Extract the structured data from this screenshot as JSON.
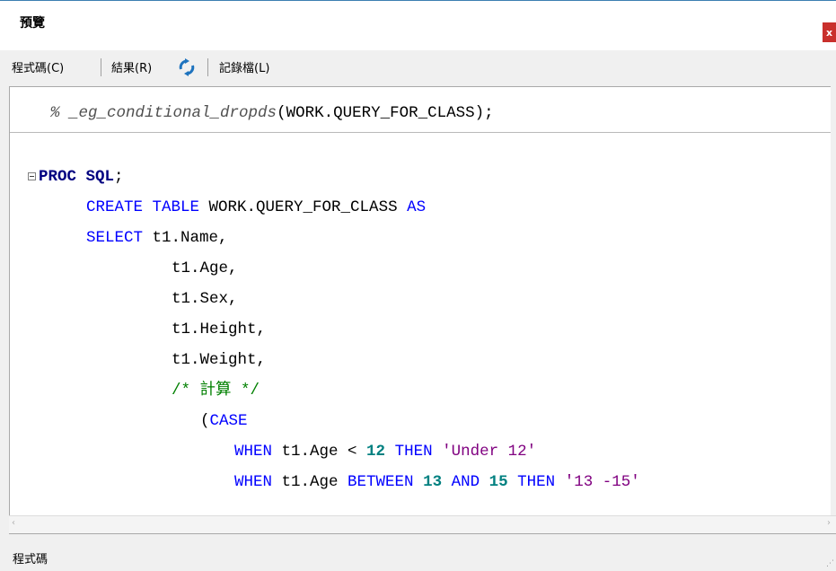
{
  "window": {
    "title": "預覽",
    "close_label": "x"
  },
  "toolbar": {
    "code_label": "程式碼(C)",
    "results_label": "結果(R)",
    "log_label": "記錄檔(L)"
  },
  "editor": {
    "lines": [
      {
        "parts": [
          [
            "macro",
            "% "
          ],
          [
            "macro",
            "_eg_conditional_dropds"
          ],
          [
            "plain",
            "(WORK.QUERY_FOR_CLASS);"
          ]
        ]
      },
      {
        "parts": [
          [
            "kwb",
            "PROC SQL"
          ],
          [
            "plain",
            ";"
          ]
        ]
      },
      {
        "parts": [
          [
            "kw",
            "CREATE TABLE"
          ],
          [
            "plain",
            " WORK.QUERY_FOR_CLASS "
          ],
          [
            "kw",
            "AS"
          ]
        ]
      },
      {
        "parts": [
          [
            "kw",
            "SELECT"
          ],
          [
            "plain",
            " t1.Name,"
          ]
        ]
      },
      {
        "parts": [
          [
            "plain",
            "t1.Age,"
          ]
        ]
      },
      {
        "parts": [
          [
            "plain",
            "t1.Sex,"
          ]
        ]
      },
      {
        "parts": [
          [
            "plain",
            "t1.Height,"
          ]
        ]
      },
      {
        "parts": [
          [
            "plain",
            "t1.Weight,"
          ]
        ]
      },
      {
        "parts": [
          [
            "cmt",
            "/* 計算 */"
          ]
        ]
      },
      {
        "parts": [
          [
            "plain",
            "("
          ],
          [
            "kw",
            "CASE"
          ]
        ]
      },
      {
        "parts": [
          [
            "kw",
            "WHEN"
          ],
          [
            "plain",
            " t1.Age < "
          ],
          [
            "num",
            "12"
          ],
          [
            "plain",
            " "
          ],
          [
            "kw",
            "THEN"
          ],
          [
            "plain",
            " "
          ],
          [
            "str",
            "'Under 12'"
          ]
        ]
      },
      {
        "parts": [
          [
            "kw",
            "WHEN"
          ],
          [
            "plain",
            " t1.Age "
          ],
          [
            "kw",
            "BETWEEN"
          ],
          [
            "plain",
            " "
          ],
          [
            "num",
            "13"
          ],
          [
            "plain",
            " "
          ],
          [
            "kw",
            "AND"
          ],
          [
            "plain",
            " "
          ],
          [
            "num",
            "15"
          ],
          [
            "plain",
            " "
          ],
          [
            "kw",
            "THEN"
          ],
          [
            "plain",
            " "
          ],
          [
            "str",
            "'13 -15'"
          ]
        ]
      }
    ]
  },
  "status": {
    "text": "程式碼"
  }
}
